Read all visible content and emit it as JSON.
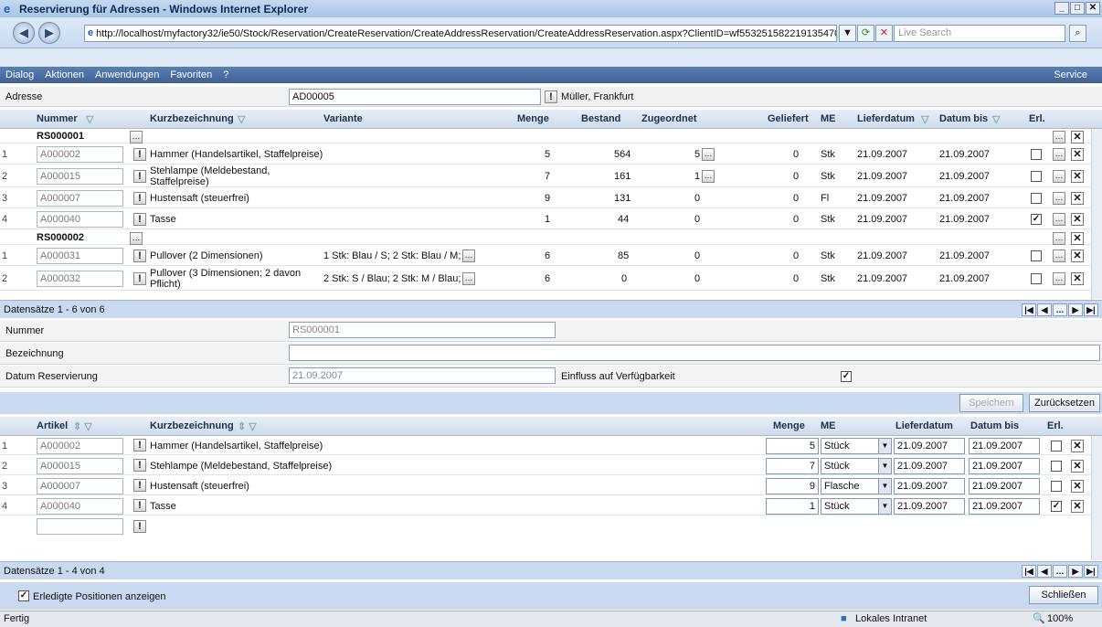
{
  "window": {
    "title": "Reservierung für Adressen - Windows Internet Explorer"
  },
  "browser": {
    "url": "http://localhost/myfactory32/ie50/Stock/Reservation/CreateReservation/CreateAddressReservation/CreateAddressReservation.aspx?ClientID=wf553251582219135470",
    "search_placeholder": "Live Search"
  },
  "menu": {
    "items": [
      "Dialog",
      "Aktionen",
      "Anwendungen",
      "Favoriten",
      "?"
    ],
    "service": "Service"
  },
  "address": {
    "label": "Adresse",
    "code": "AD00005",
    "name": "Müller, Frankfurt"
  },
  "grid1": {
    "headers": {
      "nummer": "Nummer",
      "kurz": "Kurzbezeichnung",
      "variante": "Variante",
      "menge": "Menge",
      "bestand": "Bestand",
      "zugeordnet": "Zugeordnet",
      "geliefert": "Geliefert",
      "me": "ME",
      "lieferdatum": "Lieferdatum",
      "datumbis": "Datum bis",
      "erl": "Erl."
    },
    "groups": [
      {
        "name": "RS000001",
        "rows": [
          {
            "n": "1",
            "code": "A000002",
            "kurz": "Hammer (Handelsartikel, Staffelpreise)",
            "variante": "",
            "menge": "5",
            "bestand": "564",
            "zug": "5",
            "gel": "0",
            "me": "Stk",
            "lief": "21.09.2007",
            "bis": "21.09.2007",
            "erl": false
          },
          {
            "n": "2",
            "code": "A000015",
            "kurz": "Stehlampe (Meldebestand, Staffelpreise)",
            "variante": "",
            "menge": "7",
            "bestand": "161",
            "zug": "1",
            "gel": "0",
            "me": "Stk",
            "lief": "21.09.2007",
            "bis": "21.09.2007",
            "erl": false
          },
          {
            "n": "3",
            "code": "A000007",
            "kurz": "Hustensaft (steuerfrei)",
            "variante": "",
            "menge": "9",
            "bestand": "131",
            "zug": "0",
            "gel": "0",
            "me": "Fl",
            "lief": "21.09.2007",
            "bis": "21.09.2007",
            "erl": false
          },
          {
            "n": "4",
            "code": "A000040",
            "kurz": "Tasse",
            "variante": "",
            "menge": "1",
            "bestand": "44",
            "zug": "0",
            "gel": "0",
            "me": "Stk",
            "lief": "21.09.2007",
            "bis": "21.09.2007",
            "erl": true
          }
        ]
      },
      {
        "name": "RS000002",
        "rows": [
          {
            "n": "1",
            "code": "A000031",
            "kurz": "Pullover (2 Dimensionen)",
            "variante": "1 Stk: Blau / S; 2 Stk: Blau / M; :",
            "menge": "6",
            "bestand": "85",
            "zug": "0",
            "gel": "0",
            "me": "Stk",
            "lief": "21.09.2007",
            "bis": "21.09.2007",
            "erl": false
          },
          {
            "n": "2",
            "code": "A000032",
            "kurz": "Pullover (3 Dimensionen; 2 davon Pflicht)",
            "variante": "2 Stk: S / Blau; 2 Stk: M / Blau; ;",
            "menge": "6",
            "bestand": "0",
            "zug": "0",
            "gel": "0",
            "me": "Stk",
            "lief": "21.09.2007",
            "bis": "21.09.2007",
            "erl": false
          }
        ]
      }
    ],
    "footer": "Datensätze 1 - 6 von 6"
  },
  "form": {
    "nummer_label": "Nummer",
    "nummer_value": "RS000001",
    "bez_label": "Bezeichnung",
    "bez_value": "",
    "datum_label": "Datum Reservierung",
    "datum_value": "21.09.2007",
    "einfluss_label": "Einfluss auf Verfügbarkeit",
    "einfluss_checked": true
  },
  "actions": {
    "speichern": "Speichern",
    "zuruecksetzen": "Zurücksetzen"
  },
  "grid2": {
    "headers": {
      "artikel": "Artikel",
      "kurz": "Kurzbezeichnung",
      "menge": "Menge",
      "me": "ME",
      "lieferdatum": "Lieferdatum",
      "datumbis": "Datum bis",
      "erl": "Erl."
    },
    "rows": [
      {
        "n": "1",
        "code": "A000002",
        "kurz": "Hammer (Handelsartikel, Staffelpreise)",
        "menge": "5",
        "me": "Stück",
        "lief": "21.09.2007",
        "bis": "21.09.2007",
        "erl": false
      },
      {
        "n": "2",
        "code": "A000015",
        "kurz": "Stehlampe (Meldebestand, Staffelpreise)",
        "menge": "7",
        "me": "Stück",
        "lief": "21.09.2007",
        "bis": "21.09.2007",
        "erl": false
      },
      {
        "n": "3",
        "code": "A000007",
        "kurz": "Hustensaft (steuerfrei)",
        "menge": "9",
        "me": "Flasche",
        "lief": "21.09.2007",
        "bis": "21.09.2007",
        "erl": false
      },
      {
        "n": "4",
        "code": "A000040",
        "kurz": "Tasse",
        "menge": "1",
        "me": "Stück",
        "lief": "21.09.2007",
        "bis": "21.09.2007",
        "erl": true
      }
    ],
    "footer": "Datensätze 1 - 4 von 4"
  },
  "bottom": {
    "show_done_label": "Erledigte Positionen anzeigen",
    "show_done_checked": true,
    "close": "Schließen"
  },
  "status": {
    "left": "Fertig",
    "zone": "Lokales Intranet",
    "zoom": "100%"
  }
}
